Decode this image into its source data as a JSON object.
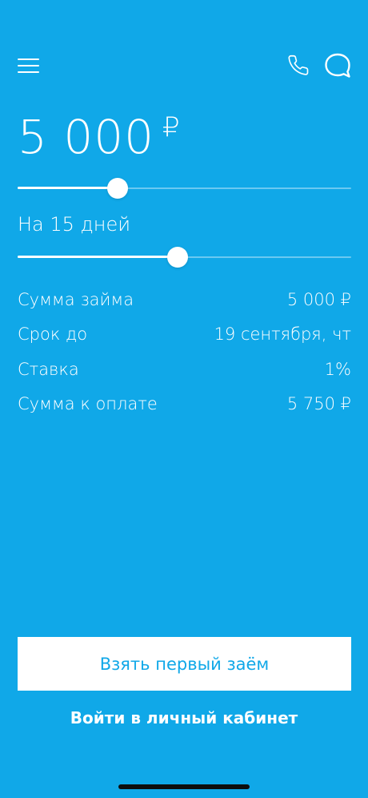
{
  "colors": {
    "background": "#10a8e8",
    "foreground": "#ffffff",
    "button_text": "#10a8e8",
    "home_indicator": "#0d0d0d"
  },
  "header": {
    "menu_icon": "hamburger-menu-icon",
    "phone_icon": "phone-icon",
    "chat_icon": "chat-bubble-icon"
  },
  "loan_amount": {
    "value": "5 000",
    "currency": "₽",
    "slider_position": 0.3
  },
  "loan_term": {
    "label": "На 15 дней",
    "slider_position": 0.48
  },
  "summary": [
    {
      "label": "Сумма займа",
      "value": "5 000 ₽"
    },
    {
      "label": "Срок до",
      "value": "19 сентября, чт"
    },
    {
      "label": "Ставка",
      "value": "1%"
    },
    {
      "label": "Сумма к оплате",
      "value": "5 750 ₽"
    }
  ],
  "actions": {
    "primary_label": "Взять первый заём",
    "login_label": "Войти в личный кабинет"
  }
}
